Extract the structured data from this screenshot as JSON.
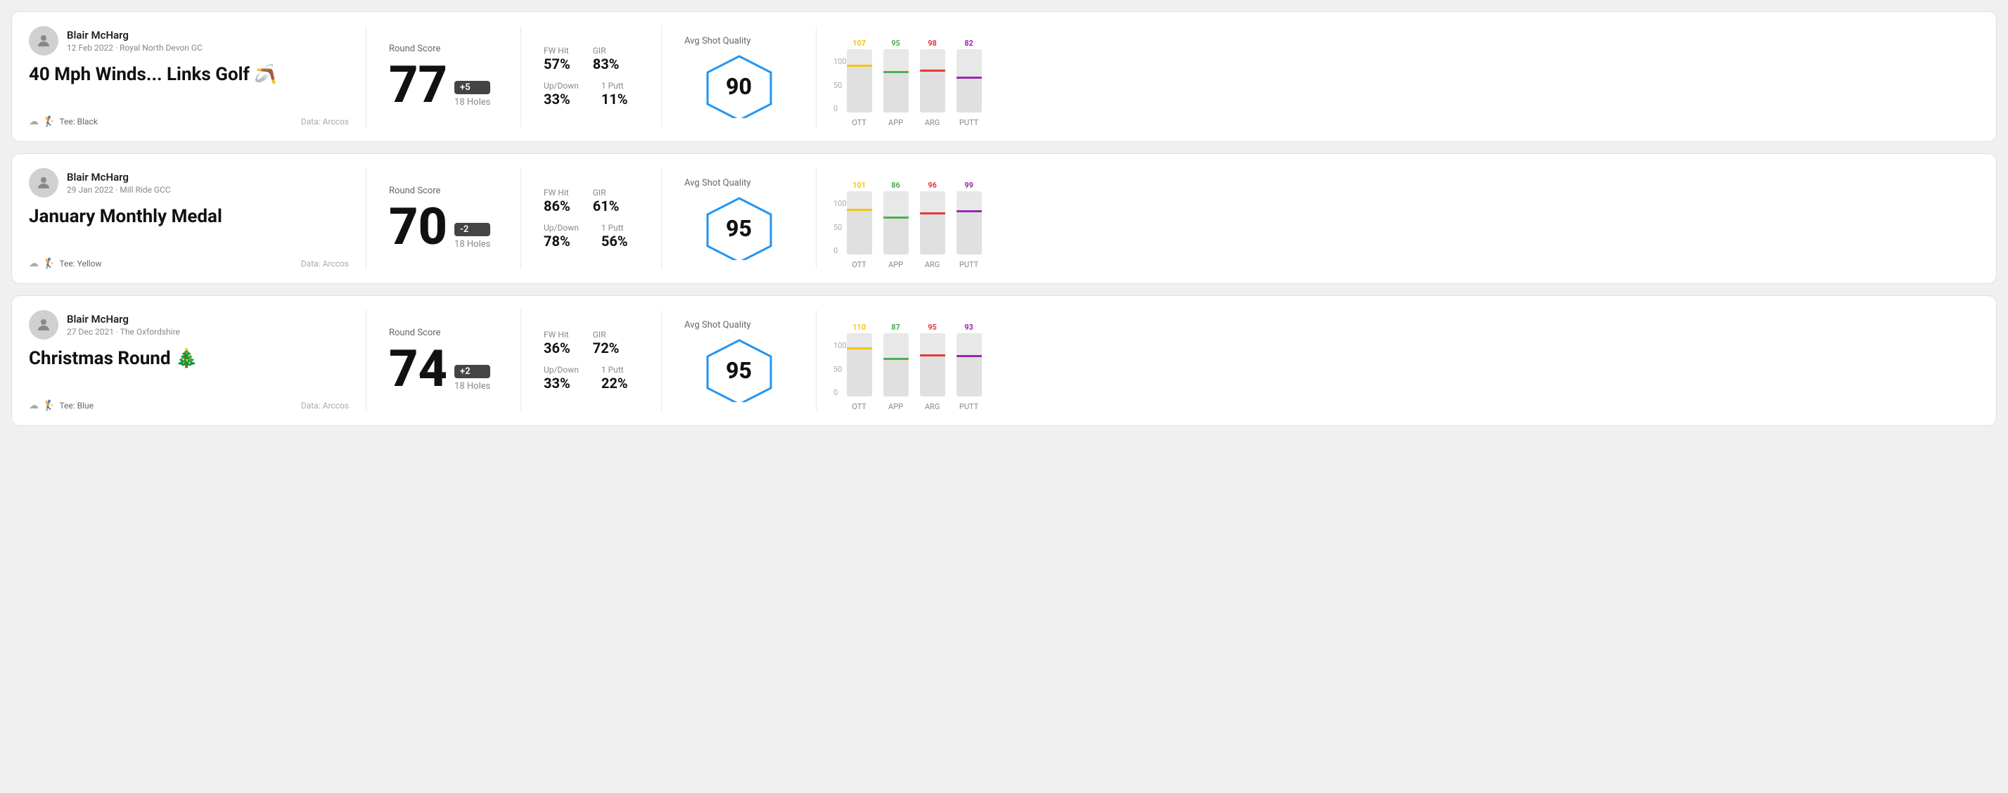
{
  "rounds": [
    {
      "id": "round1",
      "user": {
        "name": "Blair McHarg",
        "date": "12 Feb 2022",
        "course": "Royal North Devon GC"
      },
      "title": "40 Mph Winds... Links Golf 🪃",
      "tee": "Black",
      "data_source": "Data: Arccos",
      "score": {
        "label": "Round Score",
        "value": "77",
        "badge": "+5",
        "holes": "18 Holes",
        "badge_type": "dark"
      },
      "stats": {
        "fw_hit_label": "FW Hit",
        "fw_hit_value": "57%",
        "gir_label": "GIR",
        "gir_value": "83%",
        "updown_label": "Up/Down",
        "updown_value": "33%",
        "putt_label": "1 Putt",
        "putt_value": "11%"
      },
      "quality": {
        "label": "Avg Shot Quality",
        "score": "90"
      },
      "chart": {
        "bars": [
          {
            "label": "OTT",
            "value": 107,
            "color": "#f5c518",
            "fill_pct": 75
          },
          {
            "label": "APP",
            "value": 95,
            "color": "#4caf50",
            "fill_pct": 65
          },
          {
            "label": "ARG",
            "value": 98,
            "color": "#e53935",
            "fill_pct": 68
          },
          {
            "label": "PUTT",
            "value": 82,
            "color": "#9c27b0",
            "fill_pct": 57
          }
        ]
      }
    },
    {
      "id": "round2",
      "user": {
        "name": "Blair McHarg",
        "date": "29 Jan 2022",
        "course": "Mill Ride GCC"
      },
      "title": "January Monthly Medal",
      "tee": "Yellow",
      "data_source": "Data: Arccos",
      "score": {
        "label": "Round Score",
        "value": "70",
        "badge": "-2",
        "holes": "18 Holes",
        "badge_type": "dark"
      },
      "stats": {
        "fw_hit_label": "FW Hit",
        "fw_hit_value": "86%",
        "gir_label": "GIR",
        "gir_value": "61%",
        "updown_label": "Up/Down",
        "updown_value": "78%",
        "putt_label": "1 Putt",
        "putt_value": "56%"
      },
      "quality": {
        "label": "Avg Shot Quality",
        "score": "95"
      },
      "chart": {
        "bars": [
          {
            "label": "OTT",
            "value": 101,
            "color": "#f5c518",
            "fill_pct": 72
          },
          {
            "label": "APP",
            "value": 86,
            "color": "#4caf50",
            "fill_pct": 60
          },
          {
            "label": "ARG",
            "value": 96,
            "color": "#e53935",
            "fill_pct": 67
          },
          {
            "label": "PUTT",
            "value": 99,
            "color": "#9c27b0",
            "fill_pct": 70
          }
        ]
      }
    },
    {
      "id": "round3",
      "user": {
        "name": "Blair McHarg",
        "date": "27 Dec 2021",
        "course": "The Oxfordshire"
      },
      "title": "Christmas Round 🎄",
      "tee": "Blue",
      "data_source": "Data: Arccos",
      "score": {
        "label": "Round Score",
        "value": "74",
        "badge": "+2",
        "holes": "18 Holes",
        "badge_type": "dark"
      },
      "stats": {
        "fw_hit_label": "FW Hit",
        "fw_hit_value": "36%",
        "gir_label": "GIR",
        "gir_value": "72%",
        "updown_label": "Up/Down",
        "updown_value": "33%",
        "putt_label": "1 Putt",
        "putt_value": "22%"
      },
      "quality": {
        "label": "Avg Shot Quality",
        "score": "95"
      },
      "chart": {
        "bars": [
          {
            "label": "OTT",
            "value": 110,
            "color": "#f5c518",
            "fill_pct": 78
          },
          {
            "label": "APP",
            "value": 87,
            "color": "#4caf50",
            "fill_pct": 61
          },
          {
            "label": "ARG",
            "value": 95,
            "color": "#e53935",
            "fill_pct": 67
          },
          {
            "label": "PUTT",
            "value": 93,
            "color": "#9c27b0",
            "fill_pct": 65
          }
        ]
      }
    }
  ]
}
